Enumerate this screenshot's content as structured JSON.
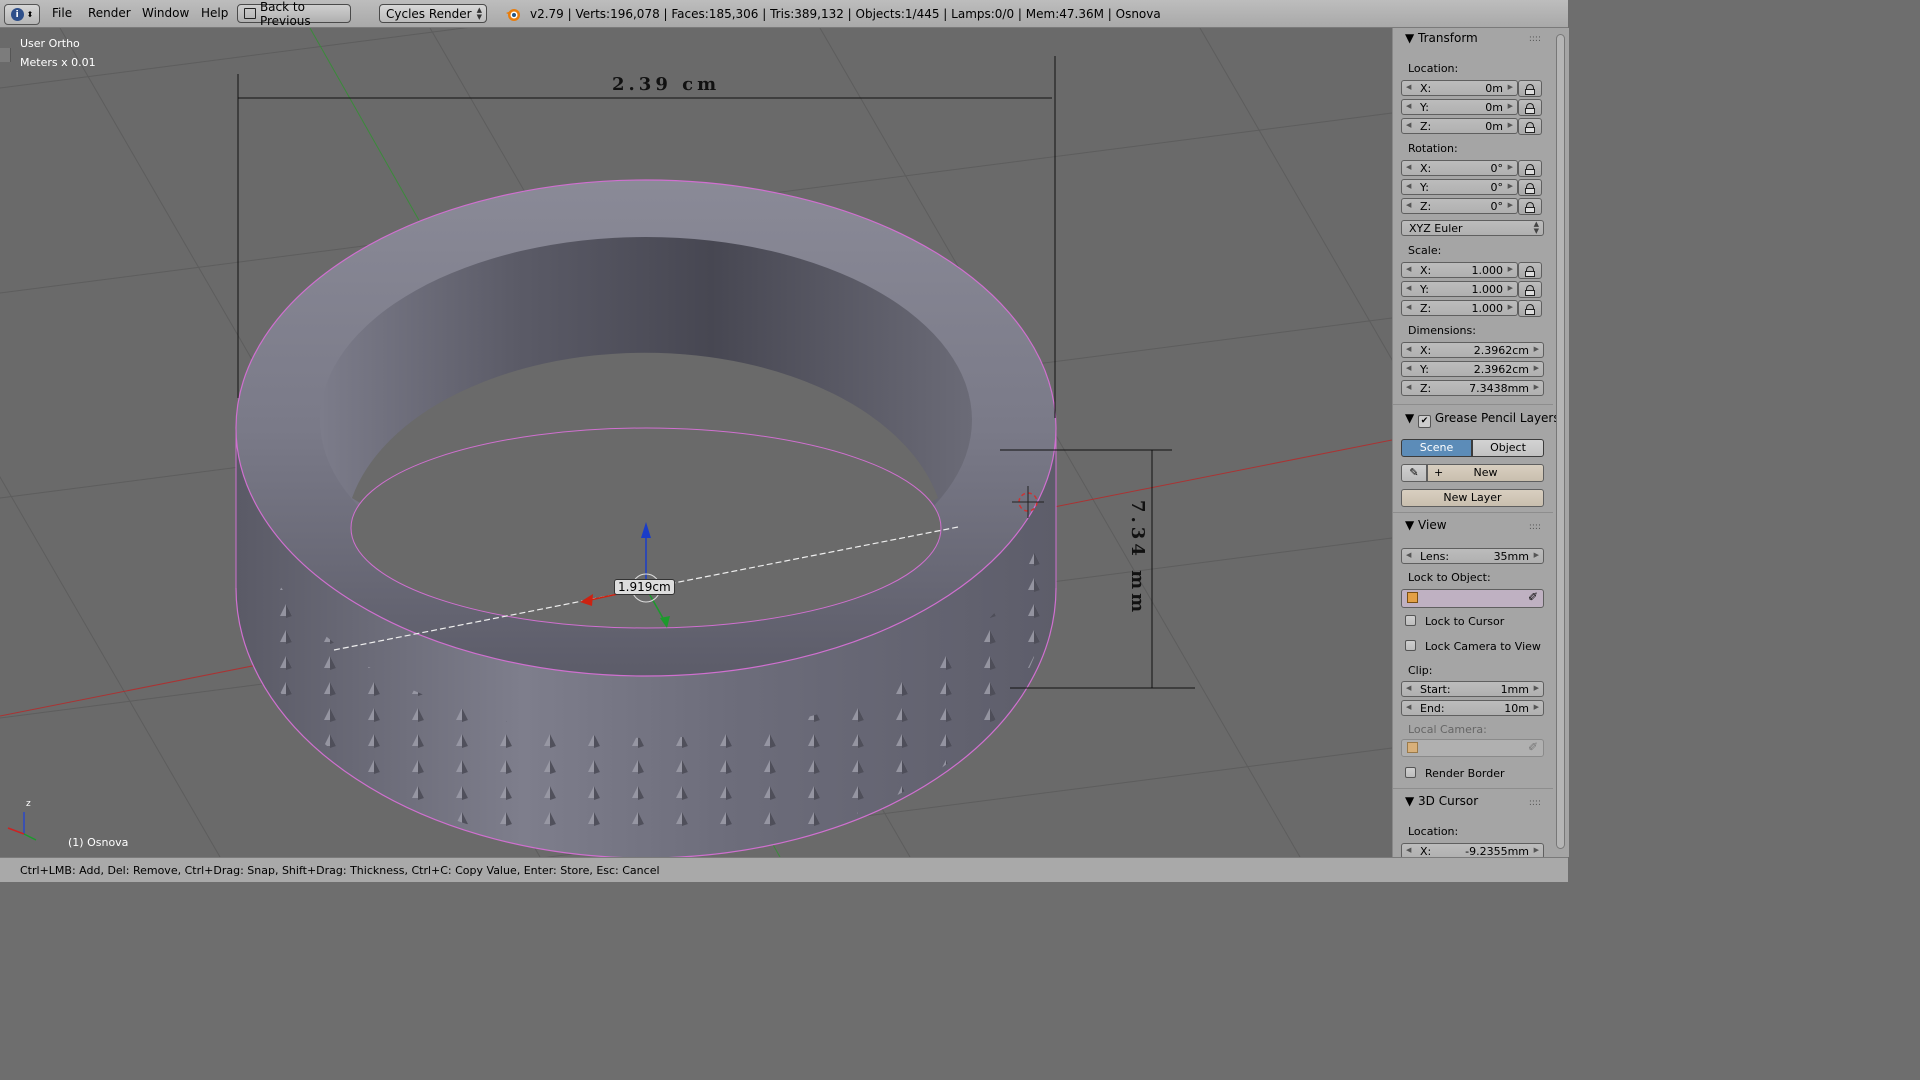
{
  "header": {
    "menus": [
      "File",
      "Render",
      "Window",
      "Help"
    ],
    "back_label": "Back to Previous",
    "render_engine": "Cycles Render",
    "stats": "v2.79 | Verts:196,078 | Faces:185,306 | Tris:389,132 | Objects:1/445 | Lamps:0/0 | Mem:47.36M | Osnova"
  },
  "viewport": {
    "view_name": "User Ortho",
    "units": "Meters x 0.01",
    "object_label": "(1) Osnova",
    "dim_width": "2.39 cm",
    "dim_height": "7.34 mm",
    "ruler_value": "1.919cm",
    "axis_z": "z"
  },
  "panel": {
    "transform": {
      "title": "Transform",
      "location_label": "Location:",
      "location": [
        {
          "axis": "X:",
          "value": "0m"
        },
        {
          "axis": "Y:",
          "value": "0m"
        },
        {
          "axis": "Z:",
          "value": "0m"
        }
      ],
      "rotation_label": "Rotation:",
      "rotation": [
        {
          "axis": "X:",
          "value": "0°"
        },
        {
          "axis": "Y:",
          "value": "0°"
        },
        {
          "axis": "Z:",
          "value": "0°"
        }
      ],
      "rotation_mode": "XYZ Euler",
      "scale_label": "Scale:",
      "scale": [
        {
          "axis": "X:",
          "value": "1.000"
        },
        {
          "axis": "Y:",
          "value": "1.000"
        },
        {
          "axis": "Z:",
          "value": "1.000"
        }
      ],
      "dimensions_label": "Dimensions:",
      "dimensions": [
        {
          "axis": "X:",
          "value": "2.3962cm"
        },
        {
          "axis": "Y:",
          "value": "2.3962cm"
        },
        {
          "axis": "Z:",
          "value": "7.3438mm"
        }
      ]
    },
    "grease": {
      "title": "Grease Pencil Layers",
      "tab_scene": "Scene",
      "tab_object": "Object",
      "new_label": "New",
      "new_layer_label": "New Layer"
    },
    "view": {
      "title": "View",
      "lens_label": "Lens:",
      "lens_value": "35mm",
      "lock_object_label": "Lock to Object:",
      "lock_cursor": "Lock to Cursor",
      "lock_camera": "Lock Camera to View",
      "clip_label": "Clip:",
      "clip_start_label": "Start:",
      "clip_start": "1mm",
      "clip_end_label": "End:",
      "clip_end": "10m",
      "local_camera_label": "Local Camera:",
      "render_border": "Render Border"
    },
    "cursor": {
      "title": "3D Cursor",
      "location_label": "Location:",
      "x_label": "X:",
      "x_value": "-9.2355mm"
    }
  },
  "status": {
    "text": "Ctrl+LMB: Add, Del: Remove, Ctrl+Drag: Snap, Shift+Drag: Thickness, Ctrl+C: Copy Value, Enter: Store,  Esc: Cancel"
  }
}
